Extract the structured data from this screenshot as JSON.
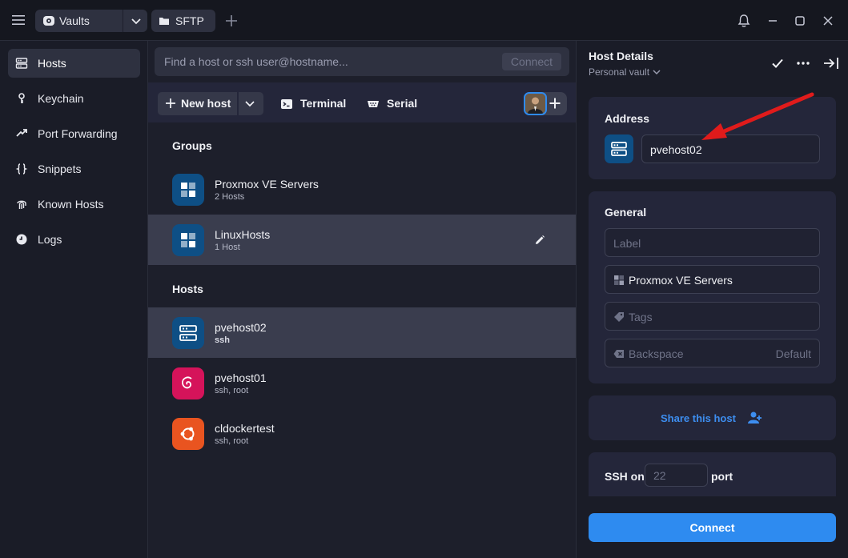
{
  "titlebar": {
    "tabs": [
      {
        "label": "Vaults",
        "icon": "vault-icon"
      },
      {
        "label": "SFTP",
        "icon": "folder-icon"
      }
    ]
  },
  "sidebar": {
    "items": [
      {
        "label": "Hosts",
        "icon": "hosts-icon",
        "active": true
      },
      {
        "label": "Keychain",
        "icon": "key-icon"
      },
      {
        "label": "Port Forwarding",
        "icon": "port-forward-icon"
      },
      {
        "label": "Snippets",
        "icon": "braces-icon"
      },
      {
        "label": "Known Hosts",
        "icon": "fingerprint-icon"
      },
      {
        "label": "Logs",
        "icon": "clock-icon"
      }
    ]
  },
  "search": {
    "placeholder": "Find a host or ssh user@hostname...",
    "connect_label": "Connect"
  },
  "toolbar": {
    "new_host": "New host",
    "terminal": "Terminal",
    "serial": "Serial"
  },
  "groups": {
    "heading": "Groups",
    "items": [
      {
        "title": "Proxmox VE Servers",
        "subtitle": "2 Hosts"
      },
      {
        "title": "LinuxHosts",
        "subtitle": "1 Host"
      }
    ]
  },
  "hosts": {
    "heading": "Hosts",
    "items": [
      {
        "title": "pvehost02",
        "subtitle": "ssh",
        "icon_color": "#0e4f85"
      },
      {
        "title": "pvehost01",
        "subtitle": "ssh, root",
        "icon_color": "#d5135a"
      },
      {
        "title": "cldockertest",
        "subtitle": "ssh, root",
        "icon_color": "#e95420"
      }
    ]
  },
  "details": {
    "title": "Host Details",
    "vault": "Personal vault",
    "address": {
      "heading": "Address",
      "value": "pvehost02"
    },
    "general": {
      "heading": "General",
      "label_placeholder": "Label",
      "group_value": "Proxmox VE Servers",
      "tags_placeholder": "Tags",
      "backspace_label": "Backspace",
      "backspace_default": "Default"
    },
    "share": "Share this host",
    "ssh": {
      "label": "SSH on",
      "port_placeholder": "22",
      "port_label": "port"
    },
    "connect": "Connect"
  },
  "colors": {
    "accent": "#2e8bf0",
    "annotation_arrow": "#e01b1b"
  }
}
